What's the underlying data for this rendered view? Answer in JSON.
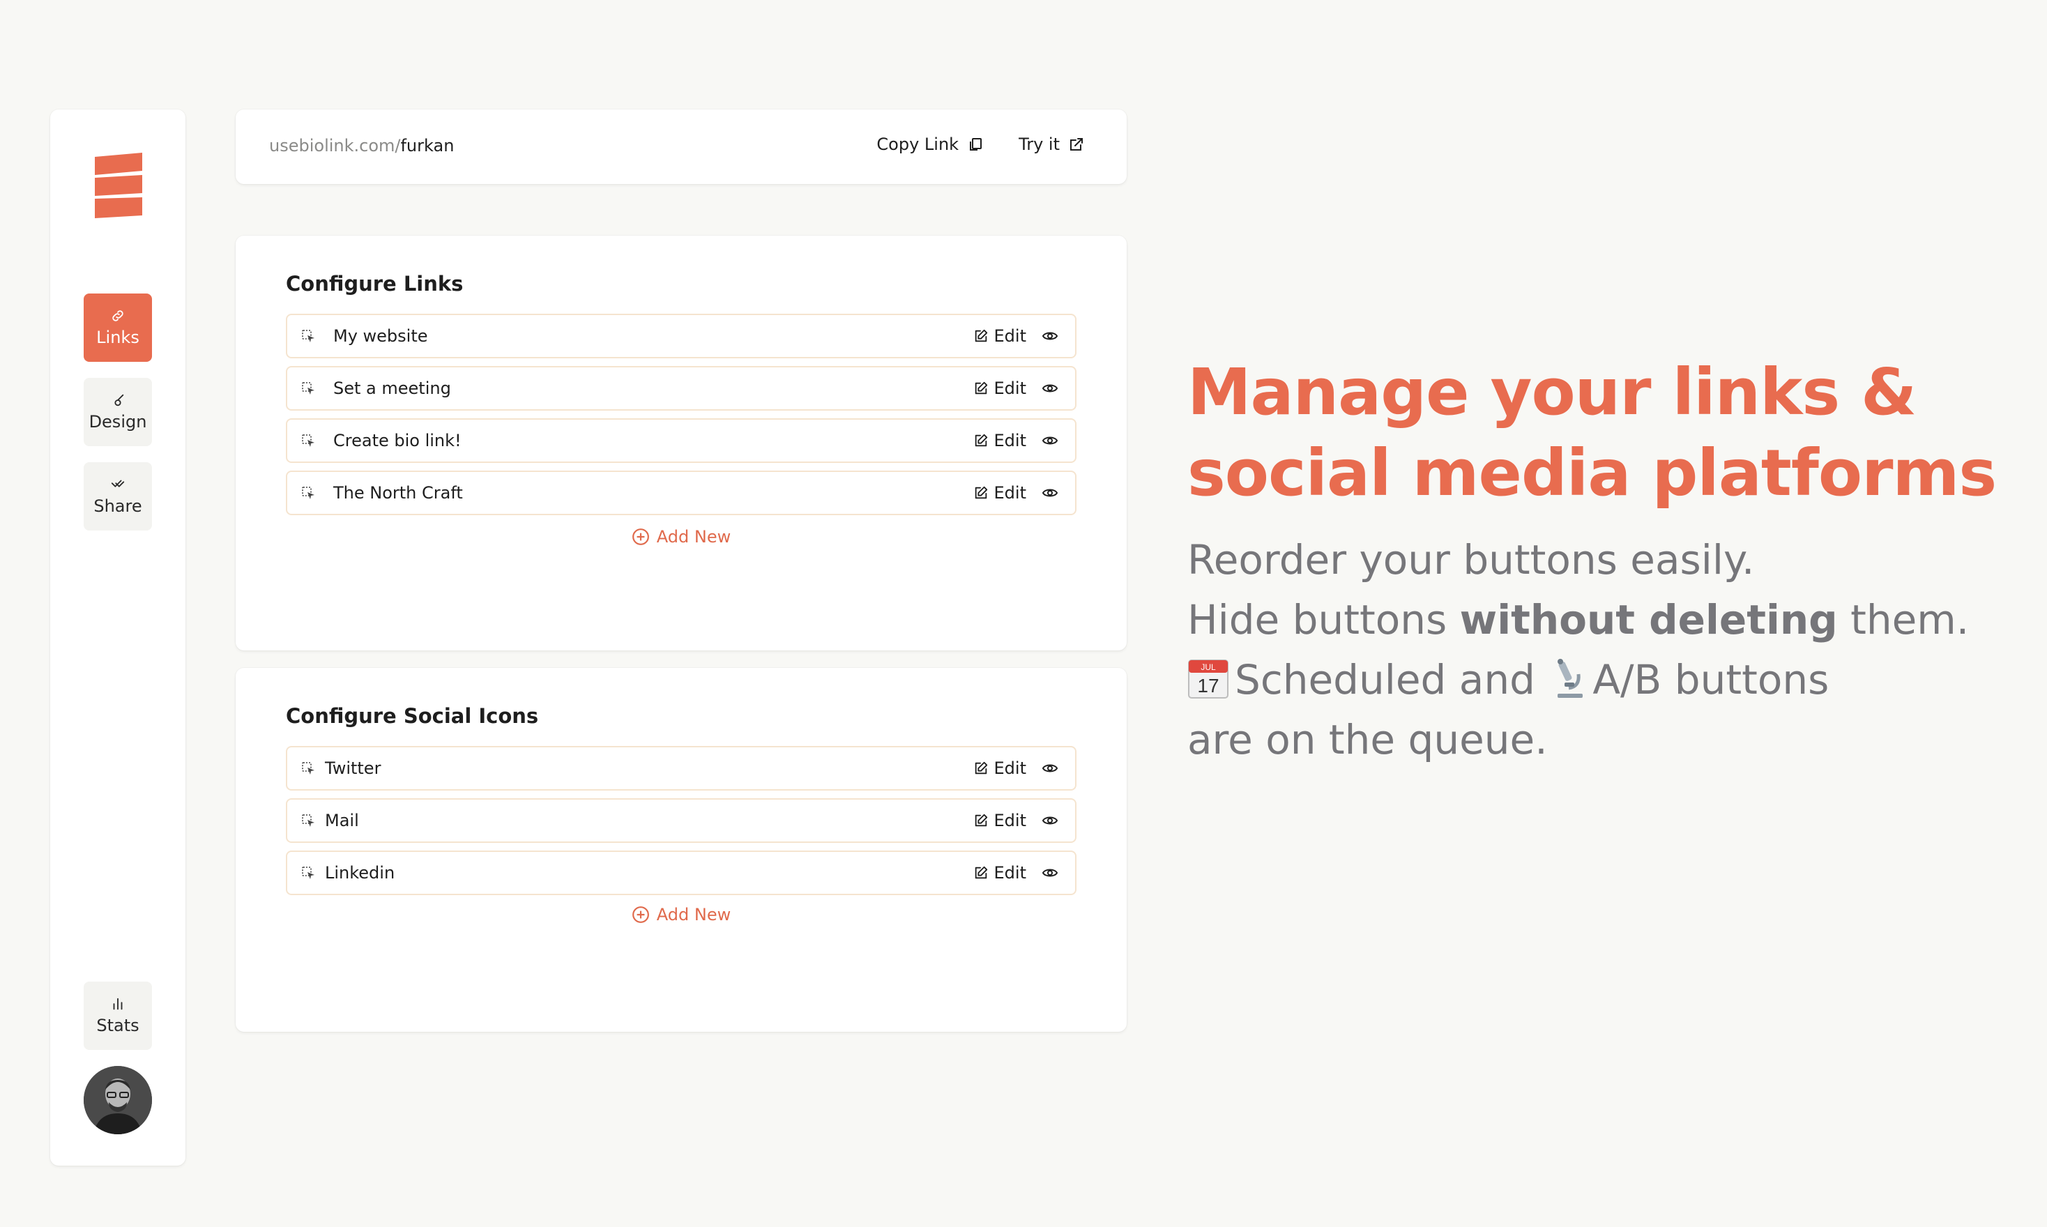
{
  "sidebar": {
    "nav": {
      "links": "Links",
      "design": "Design",
      "share": "Share",
      "stats": "Stats"
    }
  },
  "urlbar": {
    "host": "usebiolink.com/",
    "username": "furkan",
    "copy_label": "Copy Link",
    "try_label": "Try it"
  },
  "links_section": {
    "title": "Configure Links",
    "items": [
      "My website",
      "Set a meeting",
      "Create bio link!",
      "The North Craft"
    ],
    "edit_label": "Edit",
    "add_label": "Add New"
  },
  "social_section": {
    "title": "Configure Social Icons",
    "items": [
      "Twitter",
      "Mail",
      "Linkedin"
    ],
    "edit_label": "Edit",
    "add_label": "Add New"
  },
  "marketing": {
    "headline_line1": "Manage your links &",
    "headline_line2": "social media platforms",
    "sub_line1": "Reorder your buttons easily.",
    "sub_line2_pre": "Hide buttons ",
    "sub_line2_bold": "without deleting",
    "sub_line2_post": " them.",
    "sub_line3_a": "Scheduled and",
    "sub_line3_b": "A/B buttons",
    "sub_line4": "are on the queue.",
    "calendar_month": "JUL",
    "calendar_day": "17"
  },
  "colors": {
    "accent": "#e86c4f",
    "background": "#f8f8f5",
    "row_border": "#f5e4cf",
    "muted_text": "#76767a"
  },
  "icons": {
    "logo": "stacked-bars-logo",
    "links": "link-icon",
    "design": "brush-icon",
    "share": "share-icon",
    "stats": "bar-chart-icon",
    "copy": "copy-icon",
    "external": "external-link-icon",
    "drag": "drag-handle-icon",
    "edit": "edit-icon",
    "visibility": "eye-icon",
    "add": "plus-circle-icon"
  }
}
